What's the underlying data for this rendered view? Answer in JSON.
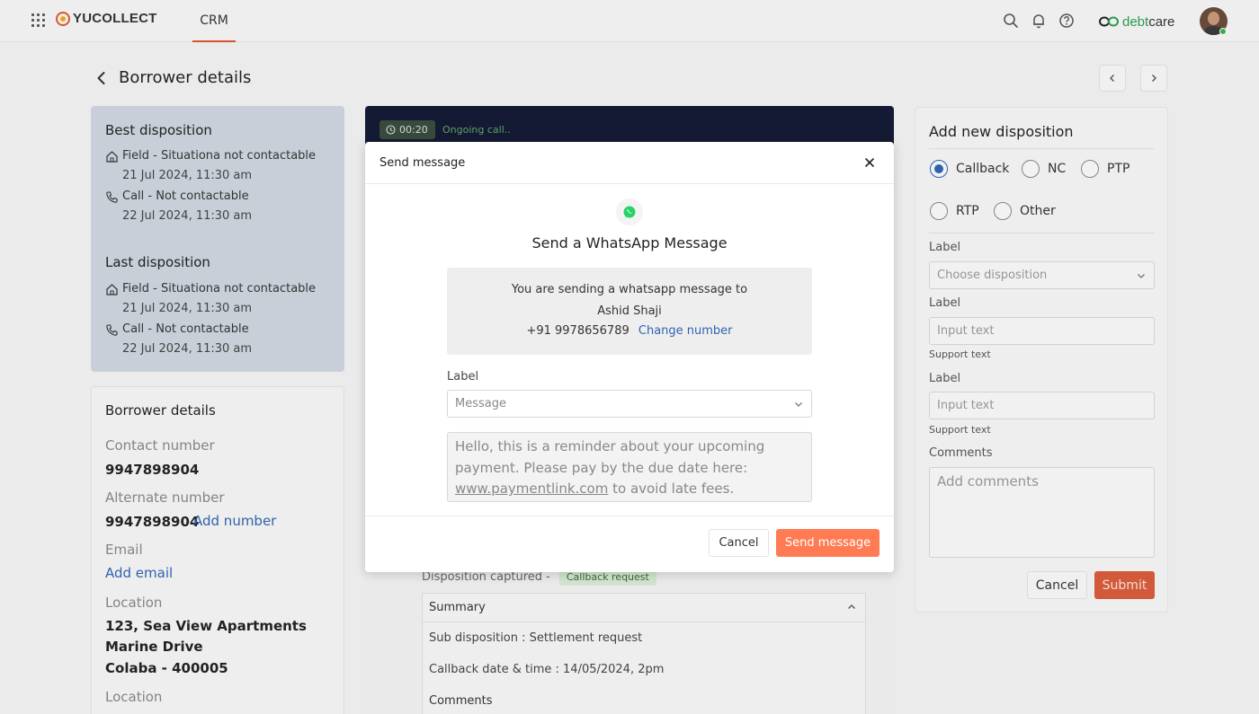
{
  "topbar": {
    "logo_text": "YUCOLLECT",
    "nav_crm": "CRM",
    "brand_part1": "debt",
    "brand_part2": "care"
  },
  "page": {
    "title": "Borrower details"
  },
  "best_disposition": {
    "heading": "Best disposition",
    "items": [
      {
        "text": "Field - Situationa not contactable",
        "date": "21 Jul 2024, 11:30 am"
      },
      {
        "text": "Call - Not contactable",
        "date": "22 Jul 2024, 11:30 am"
      }
    ]
  },
  "last_disposition": {
    "heading": "Last disposition",
    "items": [
      {
        "text": "Field - Situationa not contactable",
        "date": "21 Jul 2024, 11:30 am"
      },
      {
        "text": "Call - Not contactable",
        "date": "22 Jul 2024, 11:30 am"
      }
    ]
  },
  "borrower": {
    "heading": "Borrower details",
    "contact_label": "Contact number",
    "contact_value": "9947898904",
    "alt_label": "Alternate number",
    "alt_value": "9947898904",
    "add_number": "Add number",
    "email_label": "Email",
    "add_email": "Add email",
    "location_label": "Location",
    "location_lines": [
      "123, Sea View Apartments",
      "Marine Drive",
      "Colaba - 400005"
    ],
    "location_label_2": "Location"
  },
  "call": {
    "timer": "00:20",
    "status": "Ongoing call.."
  },
  "capture": {
    "label": "Disposition captured -",
    "tag": "Callback request"
  },
  "summary": {
    "heading": "Summary",
    "sub_disposition": "Sub disposition : Settlement request",
    "callback": "Callback date & time : 14/05/2024, 2pm",
    "comments": "Comments"
  },
  "modal": {
    "title": "Send message",
    "heading": "Send a WhatsApp Message",
    "info_line1": "You are sending a whatsapp message to",
    "recipient": "Ashid Shaji",
    "phone": "+91 9978656789",
    "change_number": "Change number",
    "label": "Label",
    "select_value": "Message",
    "message_text_1": "Hello, this is a reminder about your upcoming",
    "message_text_2": "payment. Please pay by the due date here:",
    "message_link": "www.paymentlink.com",
    "message_text_3": " to avoid late fees.",
    "cancel": "Cancel",
    "send": "Send message"
  },
  "form": {
    "heading": "Add new disposition",
    "options": [
      "Callback",
      "NC",
      "PTP",
      "RTP",
      "Other"
    ],
    "selected": "Callback",
    "label1": "Label",
    "select_placeholder": "Choose disposition",
    "label2": "Label",
    "input_placeholder": "Input text",
    "support_text": "Support text",
    "label3": "Label",
    "input_placeholder_2": "Input text",
    "support_text_2": "Support text",
    "comments_label": "Comments",
    "comments_placeholder": "Add comments",
    "cancel": "Cancel",
    "submit": "Submit"
  },
  "colors": {
    "accent": "#2f64b3",
    "primary_button": "#ff7b54",
    "submit_button": "#d95b3a",
    "nav_underline": "#e0522b"
  }
}
